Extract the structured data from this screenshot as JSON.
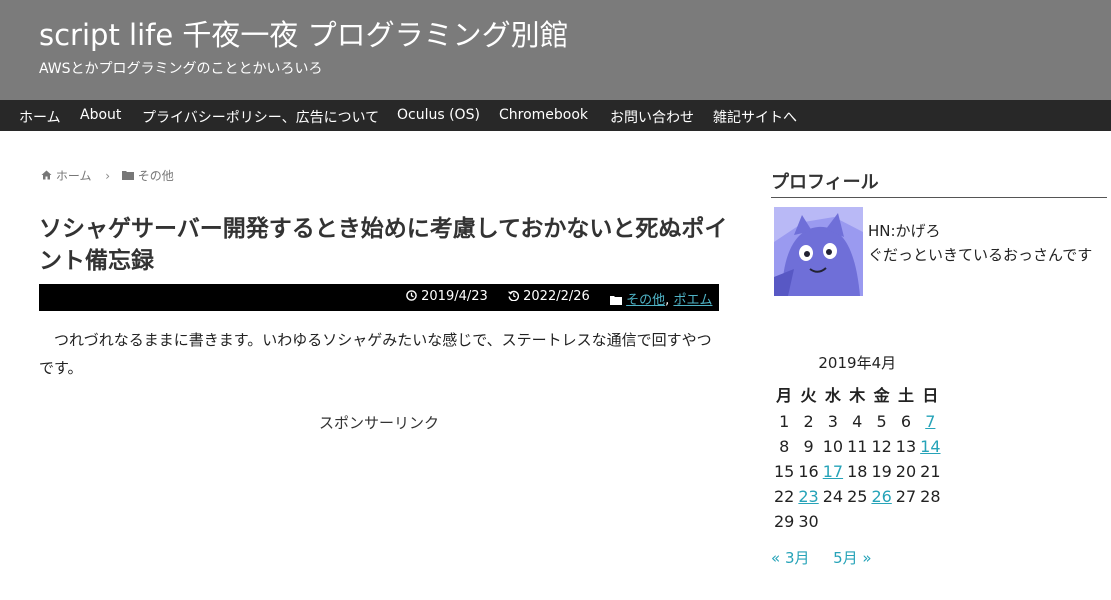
{
  "header": {
    "title": "script life 千夜一夜 プログラミング別館",
    "description": "AWSとかプログラミングのこととかいろいろ",
    "background": "#7b7b7b"
  },
  "nav": {
    "items": [
      {
        "label": "ホーム"
      },
      {
        "label": "About"
      },
      {
        "label": "プライバシーポリシー、広告について"
      },
      {
        "label": "Oculus (OS)"
      },
      {
        "label": "Chromebook"
      },
      {
        "label": "お問い合わせ"
      },
      {
        "label": "雑記サイトへ"
      }
    ]
  },
  "breadcrumb": {
    "home_icon": "home-icon",
    "home": "ホーム",
    "separator": "›",
    "category_icon": "folder-icon",
    "category": "その他"
  },
  "article": {
    "title": "ソシャゲサーバー開発するとき始めに考慮しておかないと死ぬポイント備忘録",
    "published_icon": "clock-icon",
    "published": "2019/4/23",
    "updated_icon": "history-icon",
    "updated": "2022/2/26",
    "categories": [
      "その他",
      "ポエム"
    ],
    "category_separator": ",",
    "body": "つれづれなるままに書きます。いわゆるソシャゲみたいな感じで、ステートレスな通信で回すやつです。",
    "sponsor": "スポンサーリンク"
  },
  "sidebar": {
    "profile_heading": "プロフィール",
    "profile_name": "HN:かげろ",
    "profile_desc": "ぐだっといきているおっさんです",
    "calendar": {
      "caption": "2019年4月",
      "weekdays": [
        "月",
        "火",
        "水",
        "木",
        "金",
        "土",
        "日"
      ],
      "weeks": [
        [
          "1",
          "2",
          "3",
          "4",
          "5",
          "6",
          "7"
        ],
        [
          "8",
          "9",
          "10",
          "11",
          "12",
          "13",
          "14"
        ],
        [
          "15",
          "16",
          "17",
          "18",
          "19",
          "20",
          "21"
        ],
        [
          "22",
          "23",
          "24",
          "25",
          "26",
          "27",
          "28"
        ],
        [
          "29",
          "30",
          "",
          "",
          "",
          "",
          ""
        ]
      ],
      "linked_days": [
        "7",
        "14",
        "17",
        "23",
        "26"
      ],
      "prev": "« 3月",
      "next": "5月 »"
    }
  },
  "colors": {
    "nav_bg": "#282828",
    "link": "#26a3b8",
    "meta_bg": "#000000"
  }
}
